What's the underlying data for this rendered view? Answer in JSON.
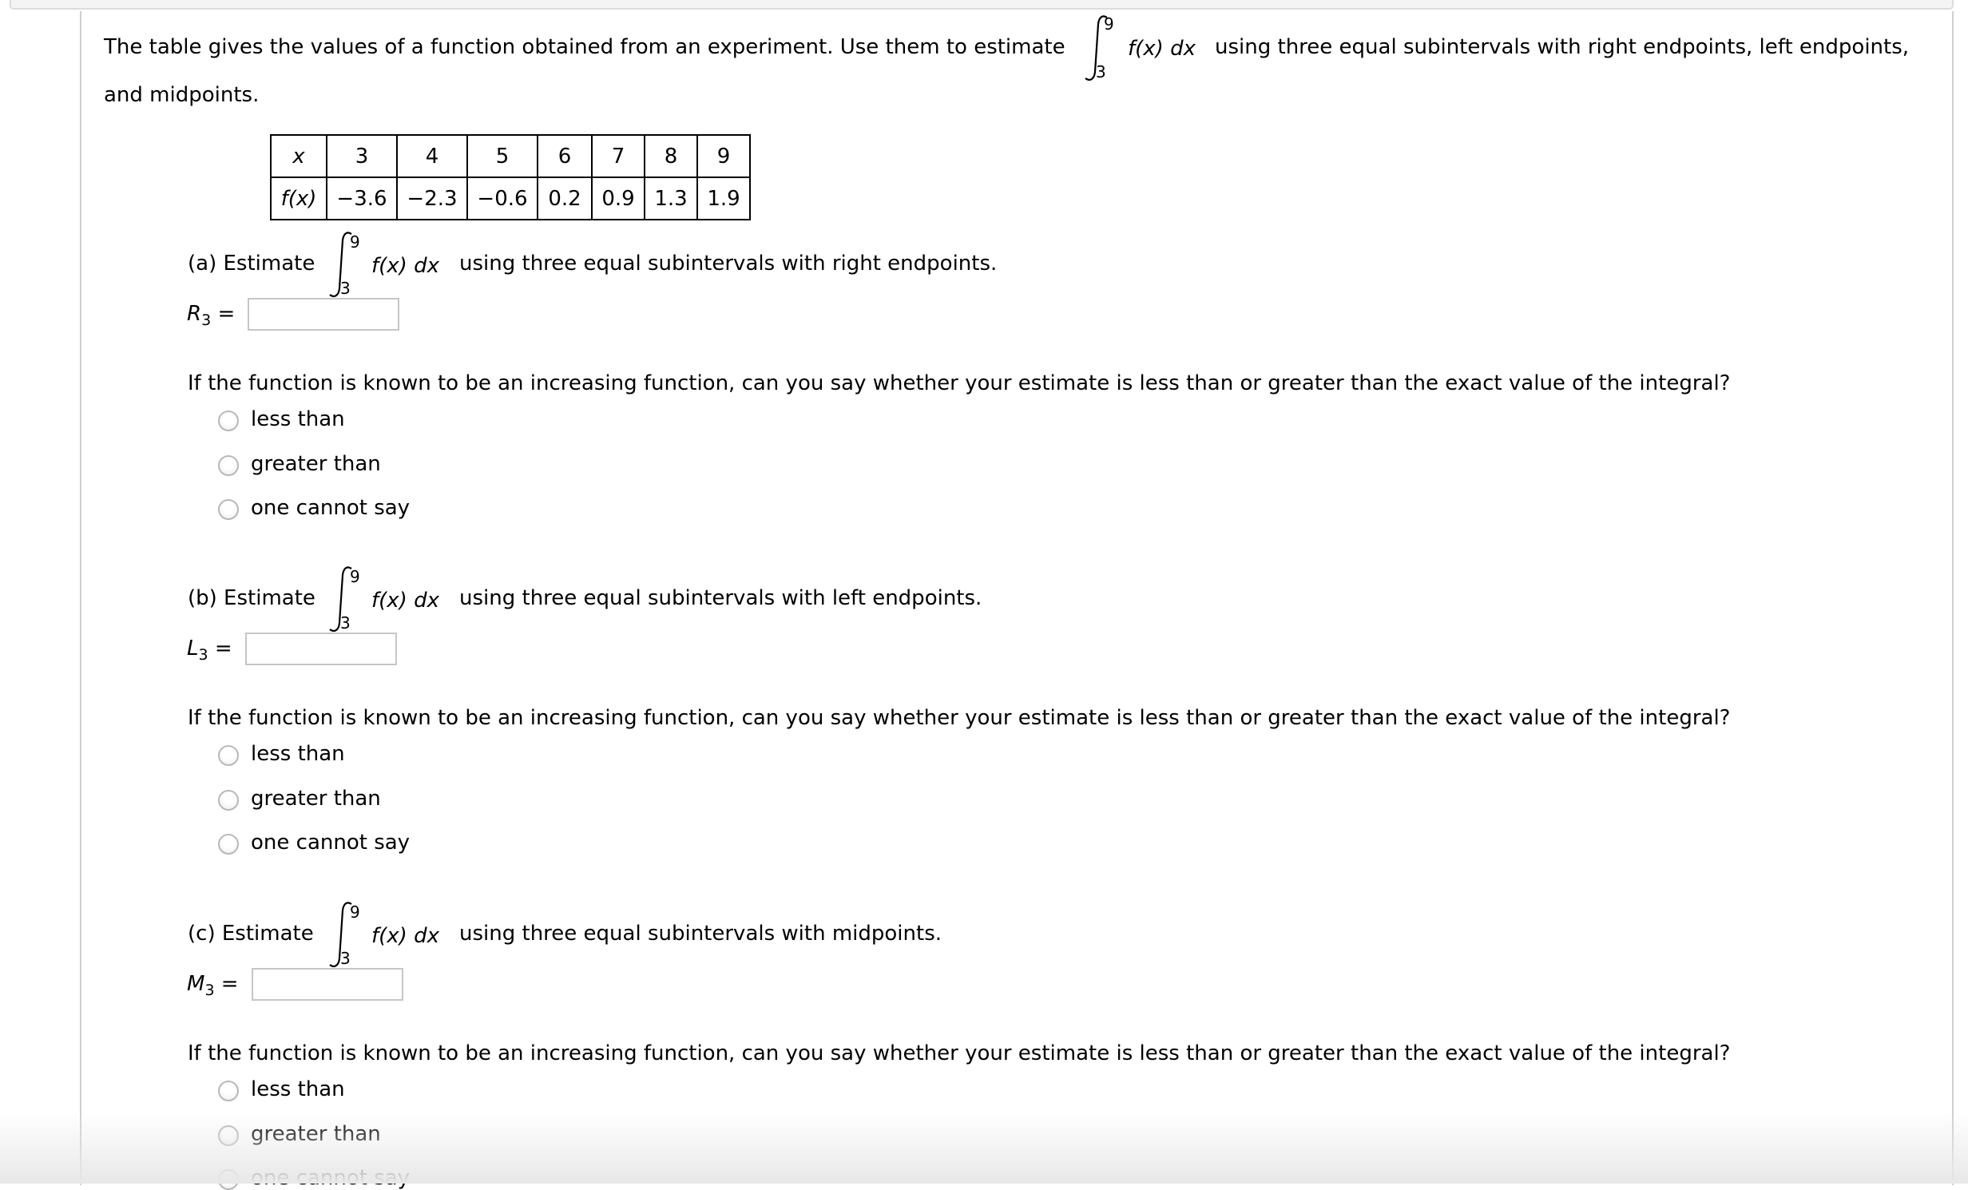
{
  "intro": {
    "text_before": "The table gives the values of a function obtained from an experiment. Use them to estimate",
    "text_after": "using three equal subintervals with right endpoints, left endpoints,",
    "line2": "and midpoints.",
    "integral": {
      "lower": "3",
      "upper": "9",
      "integrand": "f(x)",
      "differential": "dx"
    }
  },
  "table": {
    "row_labels": [
      "x",
      "f(x)"
    ],
    "x": [
      "3",
      "4",
      "5",
      "6",
      "7",
      "8",
      "9"
    ],
    "fx": [
      "−3.6",
      "−2.3",
      "−0.6",
      "0.2",
      "0.9",
      "1.3",
      "1.9"
    ]
  },
  "parts": [
    {
      "label": "(a) Estimate",
      "integral": {
        "lower": "3",
        "upper": "9",
        "integrand": "f(x)",
        "differential": "dx"
      },
      "description": "using three equal subintervals with right endpoints.",
      "answer_symbol": "R",
      "answer_sub": "3",
      "equals": "=",
      "answer_value": "",
      "question": "If the function is known to be an increasing function, can you say whether your estimate is less than or greater than the exact value of the integral?",
      "options": [
        "less than",
        "greater than",
        "one cannot say"
      ]
    },
    {
      "label": "(b) Estimate",
      "integral": {
        "lower": "3",
        "upper": "9",
        "integrand": "f(x)",
        "differential": "dx"
      },
      "description": "using three equal subintervals with left endpoints.",
      "answer_symbol": "L",
      "answer_sub": "3",
      "equals": "=",
      "answer_value": "",
      "question": "If the function is known to be an increasing function, can you say whether your estimate is less than or greater than the exact value of the integral?",
      "options": [
        "less than",
        "greater than",
        "one cannot say"
      ]
    },
    {
      "label": "(c) Estimate",
      "integral": {
        "lower": "3",
        "upper": "9",
        "integrand": "f(x)",
        "differential": "dx"
      },
      "description": "using three equal subintervals with midpoints.",
      "answer_symbol": "M",
      "answer_sub": "3",
      "equals": "=",
      "answer_value": "",
      "question": "If the function is known to be an increasing function, can you say whether your estimate is less than or greater than the exact value of the integral?",
      "options": [
        "less than",
        "greater than",
        "one cannot say"
      ]
    }
  ]
}
